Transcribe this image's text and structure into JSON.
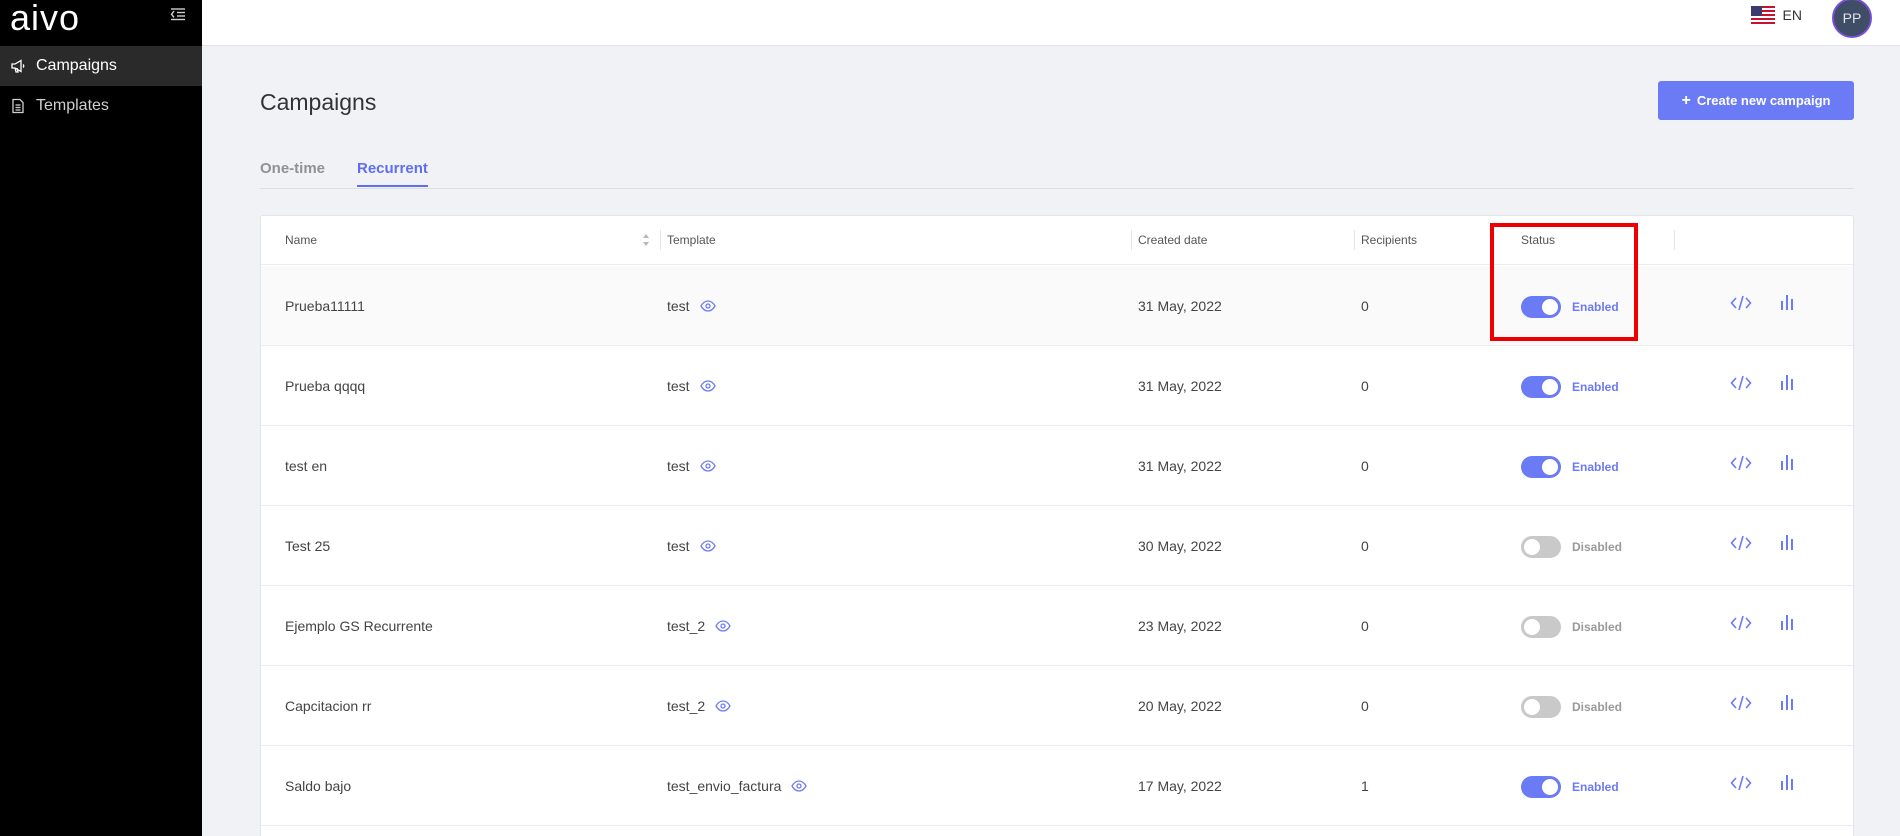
{
  "app": {
    "logo_text": "aivo"
  },
  "sidebar": {
    "items": [
      {
        "label": "Campaigns",
        "icon": "megaphone-icon",
        "active": true
      },
      {
        "label": "Templates",
        "icon": "document-icon",
        "active": false
      }
    ]
  },
  "topbar": {
    "language": "EN",
    "avatar_initials": "PP"
  },
  "page": {
    "title": "Campaigns",
    "create_button": "Create new campaign",
    "tabs": [
      {
        "label": "One-time",
        "active": false
      },
      {
        "label": "Recurrent",
        "active": true
      }
    ]
  },
  "table": {
    "columns": {
      "name": "Name",
      "template": "Template",
      "created": "Created date",
      "recipients": "Recipients",
      "status": "Status"
    },
    "rows": [
      {
        "name": "Prueba11111",
        "template": "test",
        "created": "31 May, 2022",
        "recipients": "0",
        "status": "Enabled",
        "enabled": true
      },
      {
        "name": "Prueba qqqq",
        "template": "test",
        "created": "31 May, 2022",
        "recipients": "0",
        "status": "Enabled",
        "enabled": true
      },
      {
        "name": "test en",
        "template": "test",
        "created": "31 May, 2022",
        "recipients": "0",
        "status": "Enabled",
        "enabled": true
      },
      {
        "name": "Test 25",
        "template": "test",
        "created": "30 May, 2022",
        "recipients": "0",
        "status": "Disabled",
        "enabled": false
      },
      {
        "name": "Ejemplo GS Recurrente",
        "template": "test_2",
        "created": "23 May, 2022",
        "recipients": "0",
        "status": "Disabled",
        "enabled": false
      },
      {
        "name": "Capcitacion rr",
        "template": "test_2",
        "created": "20 May, 2022",
        "recipients": "0",
        "status": "Disabled",
        "enabled": false
      },
      {
        "name": "Saldo bajo",
        "template": "test_envio_factura",
        "created": "17 May, 2022",
        "recipients": "1",
        "status": "Enabled",
        "enabled": true
      }
    ]
  },
  "colors": {
    "accent": "#6b7af5",
    "sidebar_bg": "#000000",
    "highlight": "#ee0000"
  }
}
